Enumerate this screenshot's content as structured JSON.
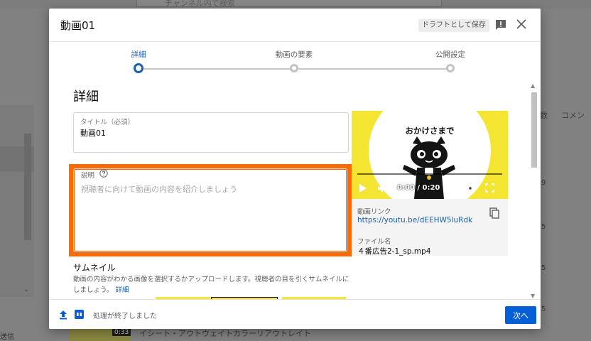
{
  "background": {
    "search_placeholder": "チャンネル内で検索",
    "right_headers": [
      "コメン",
      "数"
    ],
    "right_numbers": [
      "9",
      "5",
      "5",
      "5"
    ],
    "bottom_left_text": "送信",
    "bottom_duration": "0:33",
    "bottom_title": "イシート・アウトウェイトカラーリアウトレイト"
  },
  "dialog": {
    "title": "動画01",
    "draft_label": "ドラフトとして保存",
    "steps": [
      {
        "label": "詳細",
        "active": true
      },
      {
        "label": "動画の要素",
        "active": false
      },
      {
        "label": "公開設定",
        "active": false
      }
    ],
    "section_title": "詳細",
    "title_field": {
      "label": "タイトル（必須）",
      "value": "動画01"
    },
    "description_field": {
      "label": "説明",
      "placeholder": "視聴者に向けて動画の内容を紹介しましょう"
    },
    "thumbnail": {
      "title": "サムネイル",
      "description": "動画の内容がわかる画像を選択するかアップロードします。視聴者の目を引くサムネイルにしましょう。",
      "link": "詳細"
    },
    "preview": {
      "caption": "おかけさまで",
      "time": "0:00 / 0:20",
      "link_label": "動画リンク",
      "link_value": "https://youtu.be/dEEHW5luRdk",
      "file_label": "ファイル名",
      "file_value": "４番広告2-1_sp.mp4"
    },
    "footer": {
      "status": "処理が終了しました",
      "next_label": "次へ"
    }
  },
  "colors": {
    "accent": "#065fd4",
    "highlight": "#ff6a00",
    "video_bg": "#f4e533"
  }
}
